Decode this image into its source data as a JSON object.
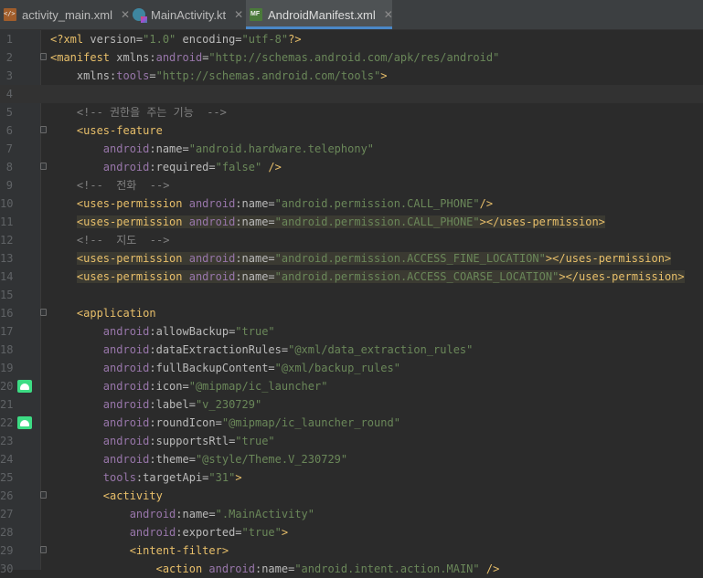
{
  "tabs": [
    {
      "label": "activity_main.xml",
      "icon": "xml-file-icon",
      "active": false
    },
    {
      "label": "MainActivity.kt",
      "icon": "kotlin-file-icon",
      "active": false
    },
    {
      "label": "AndroidManifest.xml",
      "icon": "manifest-file-icon",
      "active": true
    }
  ],
  "close_glyph": "✕",
  "current_line": 4,
  "lines": [
    {
      "n": "1",
      "tokens": [
        [
          "t-pi",
          "<?xml "
        ],
        [
          "t-attr",
          "version="
        ],
        [
          "t-val",
          "\"1.0\""
        ],
        [
          "t-attr",
          " encoding="
        ],
        [
          "t-val",
          "\"utf-8\""
        ],
        [
          "t-pi",
          "?>"
        ]
      ]
    },
    {
      "n": "2",
      "fold": true,
      "tokens": [
        [
          "t-tag",
          "<manifest "
        ],
        [
          "t-attr",
          "xmlns:"
        ],
        [
          "t-ns",
          "android"
        ],
        [
          "t-attr",
          "="
        ],
        [
          "t-val",
          "\"http://schemas.android.com/apk/res/android\""
        ]
      ]
    },
    {
      "n": "3",
      "tokens": [
        [
          "t-attr",
          "    xmlns:"
        ],
        [
          "t-ns",
          "tools"
        ],
        [
          "t-attr",
          "="
        ],
        [
          "t-val",
          "\"http://schemas.android.com/tools\""
        ],
        [
          "t-tag",
          ">"
        ]
      ]
    },
    {
      "n": "4",
      "tokens": []
    },
    {
      "n": "5",
      "tokens": [
        [
          "t-com",
          "    <!-- 권한을 주는 기능  -->"
        ]
      ]
    },
    {
      "n": "6",
      "fold": true,
      "tokens": [
        [
          "t-tag",
          "    <uses-feature"
        ]
      ]
    },
    {
      "n": "7",
      "tokens": [
        [
          "t-ns",
          "        android"
        ],
        [
          "t-attr",
          ":name="
        ],
        [
          "t-val",
          "\"android.hardware.telephony\""
        ]
      ]
    },
    {
      "n": "8",
      "fold": true,
      "tokens": [
        [
          "t-ns",
          "        android"
        ],
        [
          "t-attr",
          ":required="
        ],
        [
          "t-val",
          "\"false\""
        ],
        [
          "t-tag",
          " />"
        ]
      ]
    },
    {
      "n": "9",
      "tokens": [
        [
          "t-com",
          "    <!--  전화  -->"
        ]
      ]
    },
    {
      "n": "10",
      "tokens": [
        [
          "t-tag",
          "    <uses-permission "
        ],
        [
          "t-ns",
          "android"
        ],
        [
          "t-attr",
          ":name="
        ],
        [
          "t-val",
          "\"android.permission.CALL_PHONE\""
        ],
        [
          "t-tag",
          "/>"
        ]
      ]
    },
    {
      "n": "11",
      "hl": true,
      "tokens": [
        [
          "t-tag",
          "    <uses-permission "
        ],
        [
          "t-ns",
          "android"
        ],
        [
          "t-attr",
          ":name="
        ],
        [
          "t-val",
          "\"android.permission.CALL_PHONE\""
        ],
        [
          "t-tag",
          "></uses-permission>"
        ]
      ]
    },
    {
      "n": "12",
      "tokens": [
        [
          "t-com",
          "    <!--  지도  -->"
        ]
      ]
    },
    {
      "n": "13",
      "hl": true,
      "tokens": [
        [
          "t-tag",
          "    <uses-permission "
        ],
        [
          "t-ns",
          "android"
        ],
        [
          "t-attr",
          ":name="
        ],
        [
          "t-val",
          "\"android.permission.ACCESS_FINE_LOCATION\""
        ],
        [
          "t-tag",
          "></uses-permission>"
        ]
      ]
    },
    {
      "n": "14",
      "hl": true,
      "tokens": [
        [
          "t-tag",
          "    <uses-permission "
        ],
        [
          "t-ns",
          "android"
        ],
        [
          "t-attr",
          ":name="
        ],
        [
          "t-val",
          "\"android.permission.ACCESS_COARSE_LOCATION\""
        ],
        [
          "t-tag",
          "></uses-permission>"
        ]
      ]
    },
    {
      "n": "15",
      "tokens": []
    },
    {
      "n": "16",
      "fold": true,
      "tokens": [
        [
          "t-tag",
          "    <application"
        ]
      ]
    },
    {
      "n": "17",
      "tokens": [
        [
          "t-ns",
          "        android"
        ],
        [
          "t-attr",
          ":allowBackup="
        ],
        [
          "t-val",
          "\"true\""
        ]
      ]
    },
    {
      "n": "18",
      "tokens": [
        [
          "t-ns",
          "        android"
        ],
        [
          "t-attr",
          ":dataExtractionRules="
        ],
        [
          "t-val",
          "\"@xml/data_extraction_rules\""
        ]
      ]
    },
    {
      "n": "19",
      "tokens": [
        [
          "t-ns",
          "        android"
        ],
        [
          "t-attr",
          ":fullBackupContent="
        ],
        [
          "t-val",
          "\"@xml/backup_rules\""
        ]
      ]
    },
    {
      "n": "20",
      "gicon": true,
      "tokens": [
        [
          "t-ns",
          "        android"
        ],
        [
          "t-attr",
          ":icon="
        ],
        [
          "t-val",
          "\"@mipmap/ic_launcher\""
        ]
      ]
    },
    {
      "n": "21",
      "tokens": [
        [
          "t-ns",
          "        android"
        ],
        [
          "t-attr",
          ":label="
        ],
        [
          "t-val",
          "\"v_230729\""
        ]
      ]
    },
    {
      "n": "22",
      "gicon": true,
      "tokens": [
        [
          "t-ns",
          "        android"
        ],
        [
          "t-attr",
          ":roundIcon="
        ],
        [
          "t-val",
          "\"@mipmap/ic_launcher_round\""
        ]
      ]
    },
    {
      "n": "23",
      "tokens": [
        [
          "t-ns",
          "        android"
        ],
        [
          "t-attr",
          ":supportsRtl="
        ],
        [
          "t-val",
          "\"true\""
        ]
      ]
    },
    {
      "n": "24",
      "tokens": [
        [
          "t-ns",
          "        android"
        ],
        [
          "t-attr",
          ":theme="
        ],
        [
          "t-val",
          "\"@style/Theme.V_230729\""
        ]
      ]
    },
    {
      "n": "25",
      "tokens": [
        [
          "t-ns",
          "        tools"
        ],
        [
          "t-attr",
          ":targetApi="
        ],
        [
          "t-val",
          "\"31\""
        ],
        [
          "t-tag",
          ">"
        ]
      ]
    },
    {
      "n": "26",
      "fold": true,
      "tokens": [
        [
          "t-tag",
          "        <activity"
        ]
      ]
    },
    {
      "n": "27",
      "tokens": [
        [
          "t-ns",
          "            android"
        ],
        [
          "t-attr",
          ":name="
        ],
        [
          "t-val",
          "\".MainActivity\""
        ]
      ]
    },
    {
      "n": "28",
      "tokens": [
        [
          "t-ns",
          "            android"
        ],
        [
          "t-attr",
          ":exported="
        ],
        [
          "t-val",
          "\"true\""
        ],
        [
          "t-tag",
          ">"
        ]
      ]
    },
    {
      "n": "29",
      "fold": true,
      "tokens": [
        [
          "t-tag",
          "            <intent-filter>"
        ]
      ]
    },
    {
      "n": "30",
      "tokens": [
        [
          "t-tag",
          "                <action "
        ],
        [
          "t-ns",
          "android"
        ],
        [
          "t-attr",
          ":name="
        ],
        [
          "t-val",
          "\"android.intent.action.MAIN\""
        ],
        [
          "t-tag",
          " />"
        ]
      ]
    }
  ]
}
